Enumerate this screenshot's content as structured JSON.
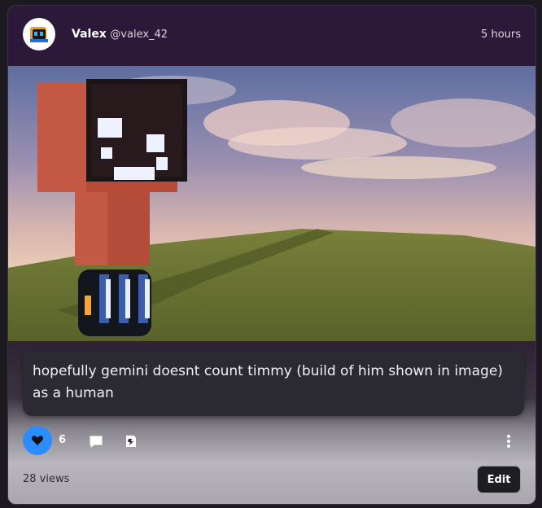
{
  "post": {
    "author_name": "Valex",
    "author_handle": "@valex_42",
    "time": "5 hours",
    "caption": "hopefully gemini doesnt count timmy (build of him shown in image) as a human",
    "likes": "6",
    "views": "28 views",
    "edit_label": "Edit"
  },
  "colors": {
    "accent": "#2d8cff",
    "card_bg": "#2c1838",
    "caption_bg": "#2b2932"
  },
  "icons": {
    "avatar": "avatar-logo-icon",
    "like": "heart-icon",
    "comment": "comment-bubble-icon",
    "remix": "remix-icon",
    "more": "more-vertical-icon"
  }
}
